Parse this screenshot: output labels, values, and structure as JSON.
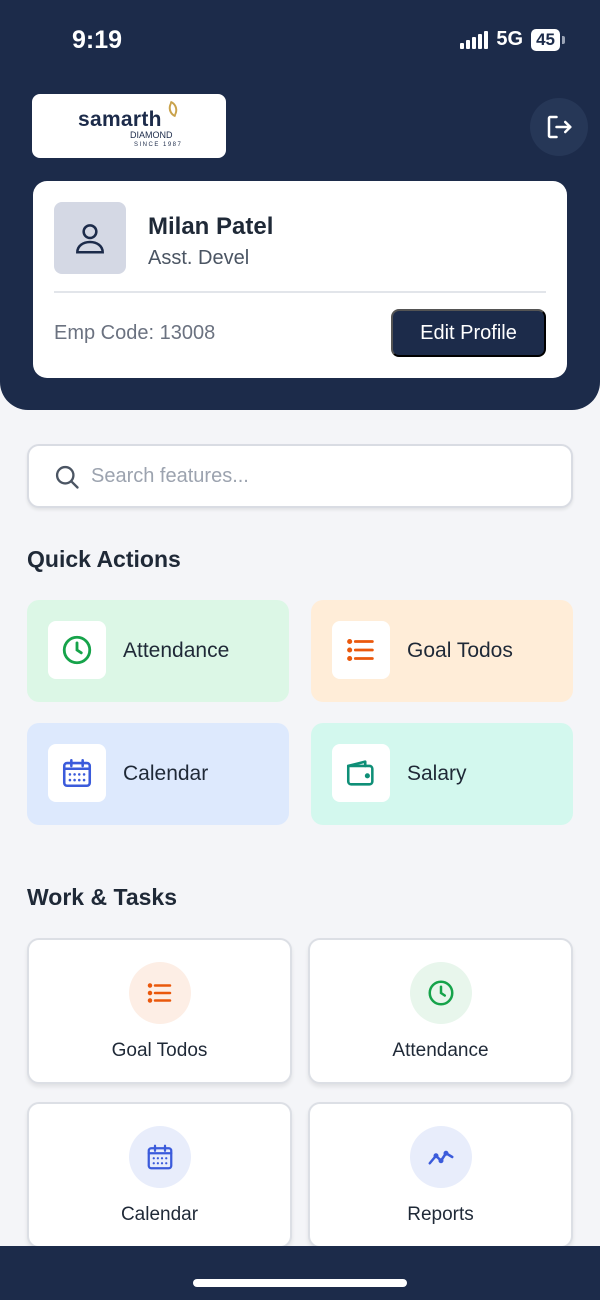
{
  "status_bar": {
    "time": "9:19",
    "network": "5G",
    "battery": "45"
  },
  "brand": {
    "name": "samarth",
    "sub": "DIAMOND",
    "since": "SINCE 1987"
  },
  "profile": {
    "name": "Milan Patel",
    "role": "Asst. Devel",
    "emp_code": "Emp Code: 13008",
    "edit_label": "Edit Profile"
  },
  "search": {
    "placeholder": "Search features..."
  },
  "quick_actions": {
    "title": "Quick Actions",
    "items": [
      {
        "label": "Attendance",
        "icon": "clock-icon",
        "bg": "#dcf7e6",
        "color": "#16a34a"
      },
      {
        "label": "Goal Todos",
        "icon": "list-icon",
        "bg": "#ffedd8",
        "color": "#ea580c"
      },
      {
        "label": "Calendar",
        "icon": "calendar-icon",
        "bg": "#dde9fd",
        "color": "#3b5bdb"
      },
      {
        "label": "Salary",
        "icon": "wallet-icon",
        "bg": "#d3f8ee",
        "color": "#0f8f77"
      }
    ]
  },
  "work_tasks": {
    "title": "Work & Tasks",
    "items": [
      {
        "label": "Goal Todos",
        "icon": "list-icon",
        "bg": "#fdeee5",
        "color": "#ea580c"
      },
      {
        "label": "Attendance",
        "icon": "clock-icon",
        "bg": "#e8f6ec",
        "color": "#16a34a"
      },
      {
        "label": "Calendar",
        "icon": "calendar-icon",
        "bg": "#e8edfb",
        "color": "#3b5bdb"
      },
      {
        "label": "Reports",
        "icon": "chart-icon",
        "bg": "#e8edfb",
        "color": "#3b5bdb"
      }
    ]
  },
  "colors": {
    "primary": "#1c2b4a",
    "background": "#f4f5f8"
  }
}
